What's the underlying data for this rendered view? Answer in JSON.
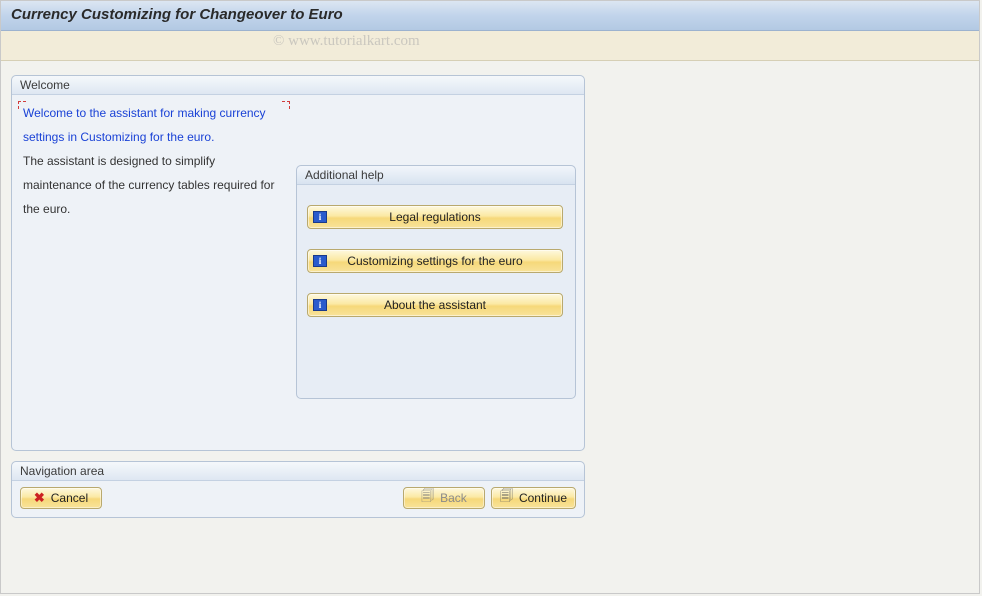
{
  "header": {
    "title": "Currency Customizing for Changeover to Euro"
  },
  "watermark": "© www.tutorialkart.com",
  "welcome": {
    "box_title": "Welcome",
    "intro_highlight": "Welcome to the assistant for making currency settings in Customizing for the euro.",
    "intro_rest": "The assistant is designed to simplify maintenance of the currency tables required for the euro."
  },
  "additional_help": {
    "box_title": "Additional help",
    "buttons": [
      {
        "label": "Legal regulations"
      },
      {
        "label": "Customizing settings for the euro"
      },
      {
        "label": "About the assistant"
      }
    ]
  },
  "navigation": {
    "box_title": "Navigation area",
    "cancel": "Cancel",
    "back": "Back",
    "continue": "Continue"
  }
}
